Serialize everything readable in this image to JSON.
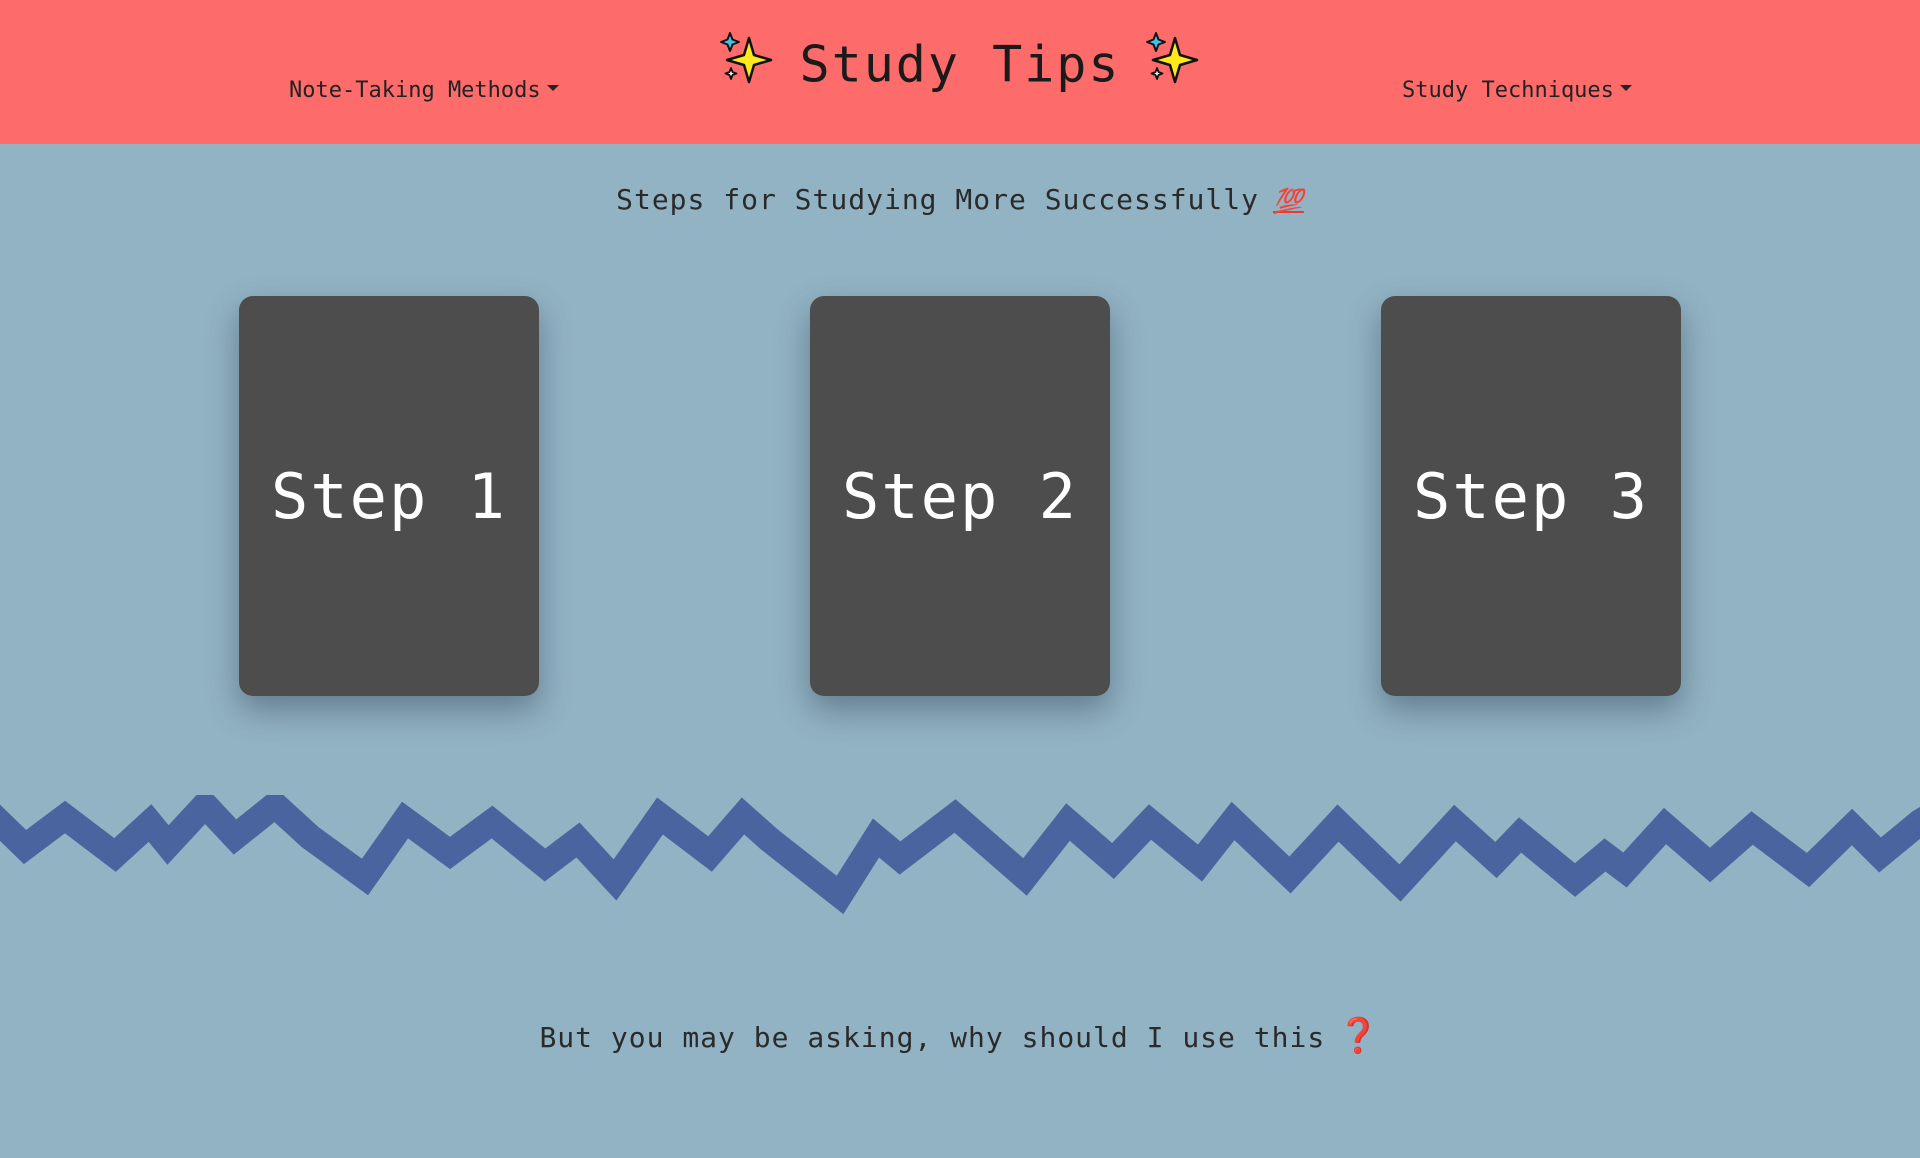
{
  "header": {
    "title": "Study Tips",
    "nav_left": "Note-Taking Methods",
    "nav_right": "Study Techniques"
  },
  "steps_section": {
    "heading": "Steps for Studying More Successfully",
    "heading_emoji": "💯",
    "cards": [
      "Step 1",
      "Step 2",
      "Step 3"
    ]
  },
  "question": {
    "text": "But you may be asking, why should I use this",
    "emoji": "❓"
  },
  "colors": {
    "header_bg": "#fe6b6b",
    "page_bg": "#92b3c4",
    "card_bg": "#4d4d4d",
    "zigzag": "#4a649f"
  },
  "icons": {
    "title_left": "sparkles-icon",
    "title_right": "sparkles-icon"
  }
}
